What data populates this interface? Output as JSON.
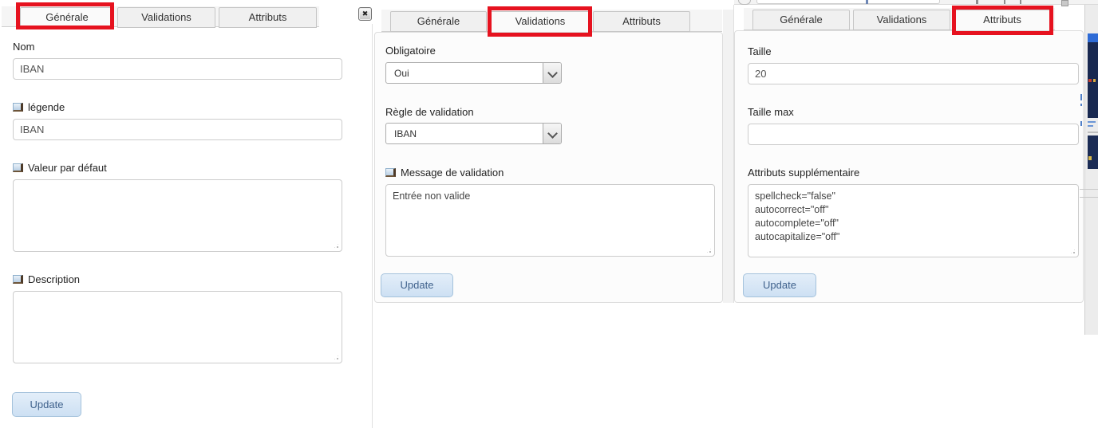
{
  "annotation_color": "#e6121f",
  "icons": {
    "close": "✖"
  },
  "panels": [
    {
      "name": "generale",
      "active_tab": "Générale",
      "tabs": [
        {
          "label": "Générale"
        },
        {
          "label": "Validations"
        },
        {
          "label": "Attributs"
        }
      ],
      "fields": {
        "nom": {
          "label": "Nom",
          "value": "IBAN"
        },
        "legende": {
          "label": "légende",
          "value": "IBAN"
        },
        "valeur_par_defaut": {
          "label": "Valeur par défaut",
          "value": ""
        },
        "description": {
          "label": "Description",
          "value": ""
        }
      },
      "update_label": "Update"
    },
    {
      "name": "validations",
      "active_tab": "Validations",
      "tabs": [
        {
          "label": "Générale"
        },
        {
          "label": "Validations"
        },
        {
          "label": "Attributs"
        }
      ],
      "fields": {
        "obligatoire": {
          "label": "Obligatoire",
          "value": "Oui"
        },
        "regle": {
          "label": "Règle de validation",
          "value": "IBAN"
        },
        "message": {
          "label": "Message de validation",
          "value": "Entrée non valide"
        }
      },
      "update_label": "Update"
    },
    {
      "name": "attributs",
      "active_tab": "Attributs",
      "tabs": [
        {
          "label": "Générale"
        },
        {
          "label": "Validations"
        },
        {
          "label": "Attributs"
        }
      ],
      "fields": {
        "taille": {
          "label": "Taille",
          "value": "20"
        },
        "taille_max": {
          "label": "Taille max",
          "value": ""
        },
        "attributs_supplementaire": {
          "label": "Attributs supplémentaire",
          "value": "spellcheck=\"false\"\nautocorrect=\"off\"\nautocomplete=\"off\"\nautocapitalize=\"off\""
        }
      },
      "update_label": "Update"
    }
  ]
}
